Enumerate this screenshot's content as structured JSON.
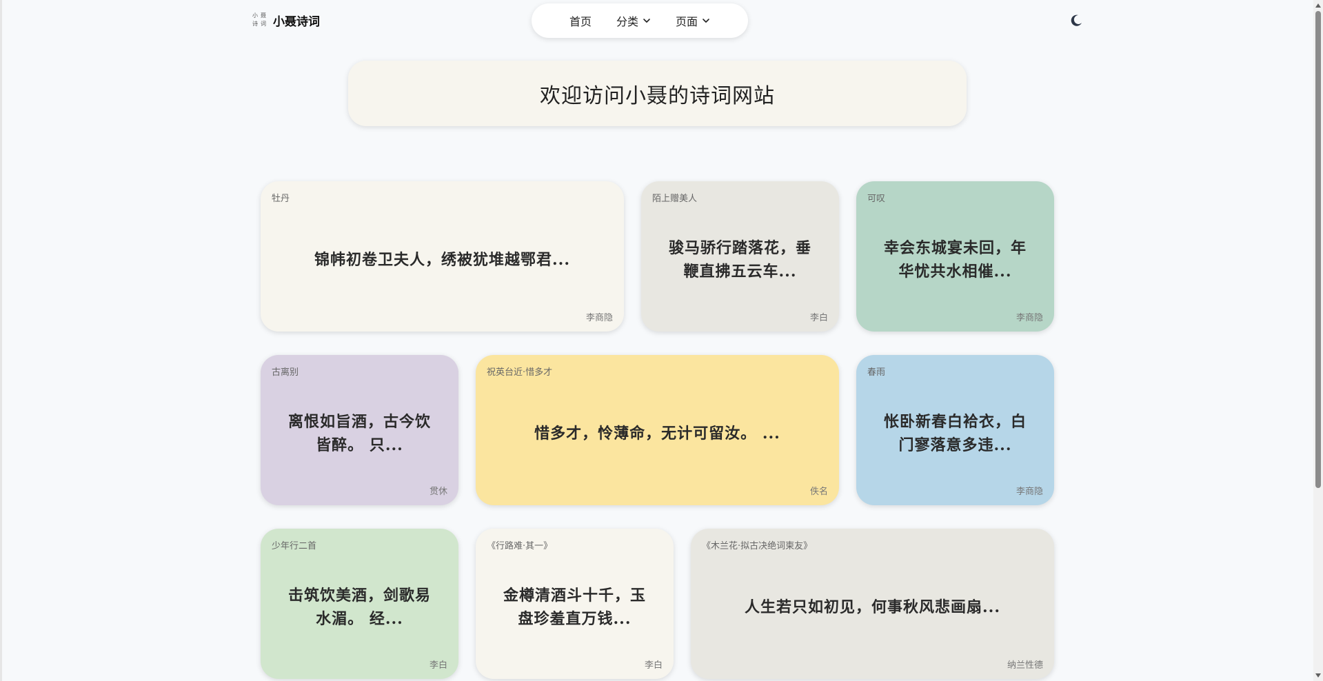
{
  "brand": {
    "logo_chars": [
      "小",
      "聂",
      "诗",
      "词"
    ],
    "name": "小聂诗词"
  },
  "nav": {
    "home": "首页",
    "categories": "分类",
    "pages": "页面"
  },
  "theme_toggle_icon": "moon-icon",
  "banner": {
    "title": "欢迎访问小聂的诗词网站"
  },
  "cards": [
    {
      "title": "牡丹",
      "text": "锦帏初卷卫夫人，绣被犹堆越鄂君...",
      "author": "李商隐",
      "color": "#f7f5ee"
    },
    {
      "title": "陌上赠美人",
      "text": "骏马骄行踏落花，垂鞭直拂五云车...",
      "author": "李白",
      "color": "#e8e7e1"
    },
    {
      "title": "可叹",
      "text": "幸会东城宴未回，年华忧共水相催...",
      "author": "李商隐",
      "color": "#b6d6c7"
    },
    {
      "title": "古离别",
      "text": "离恨如旨酒，古今饮皆醉。 只...",
      "author": "贯休",
      "color": "#d9d1e2"
    },
    {
      "title": "祝英台近·惜多才",
      "text": "惜多才，怜薄命，无计可留汝。 ...",
      "author": "佚名",
      "color": "#fbe59f"
    },
    {
      "title": "春雨",
      "text": "怅卧新春白袷衣，白门寥落意多违...",
      "author": "李商隐",
      "color": "#b6d6e8"
    },
    {
      "title": "少年行二首",
      "text": "击筑饮美酒，剑歌易水湄。 经...",
      "author": "李白",
      "color": "#d1e6cd"
    },
    {
      "title": "《行路难·其一》",
      "text": "金樽清酒斗十千，玉盘珍羞直万钱...",
      "author": "李白",
      "color": "#f7f5ee"
    },
    {
      "title": "《木兰花·拟古决绝词柬友》",
      "text": "人生若只如初见，何事秋风悲画扇...",
      "author": "纳兰性德",
      "color": "#e8e7e1"
    }
  ]
}
